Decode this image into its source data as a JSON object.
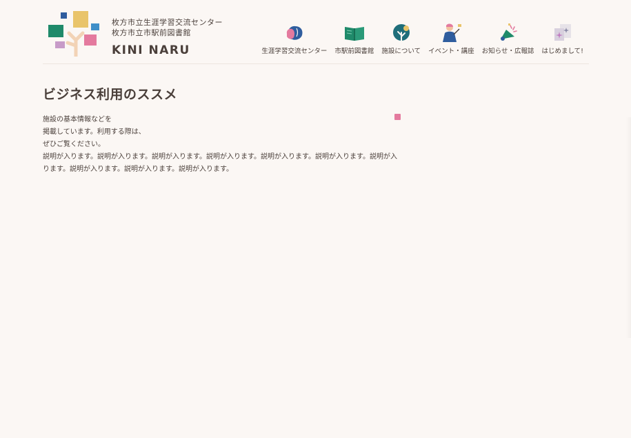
{
  "header": {
    "logo": {
      "line1": "枚方市立生涯学習交流センター",
      "line2": "枚方市立市駅前図書館",
      "brand": "KINI NARU"
    },
    "nav": [
      {
        "label": "生涯学習交流センター",
        "icon": "brain-icon"
      },
      {
        "label": "市駅前図書館",
        "icon": "book-icon"
      },
      {
        "label": "施設について",
        "icon": "tree-icon"
      },
      {
        "label": "イベント・講座",
        "icon": "lecturer-icon"
      },
      {
        "label": "お知らせ・広報誌",
        "icon": "megaphone-icon"
      },
      {
        "label": "はじめまして!",
        "icon": "sparkle-card-icon"
      }
    ]
  },
  "main": {
    "title": "ビジネス利用のススメ",
    "description": [
      "施設の基本情報などを",
      "掲載しています。利用する際は、",
      "ぜひご覧ください。",
      "説明が入ります。説明が入ります。説明が入ります。説明が入ります。説明が入ります。説明が入ります。説明が入ります。説明が入ります。説明が入ります。説明が入ります。"
    ]
  },
  "colors": {
    "background": "#fbf7f4",
    "text": "#4a3f3a",
    "accent_pink": "#e47a9e",
    "accent_blue": "#2f5d9e",
    "accent_green": "#1f8a6a",
    "accent_yellow": "#e9c46a"
  }
}
